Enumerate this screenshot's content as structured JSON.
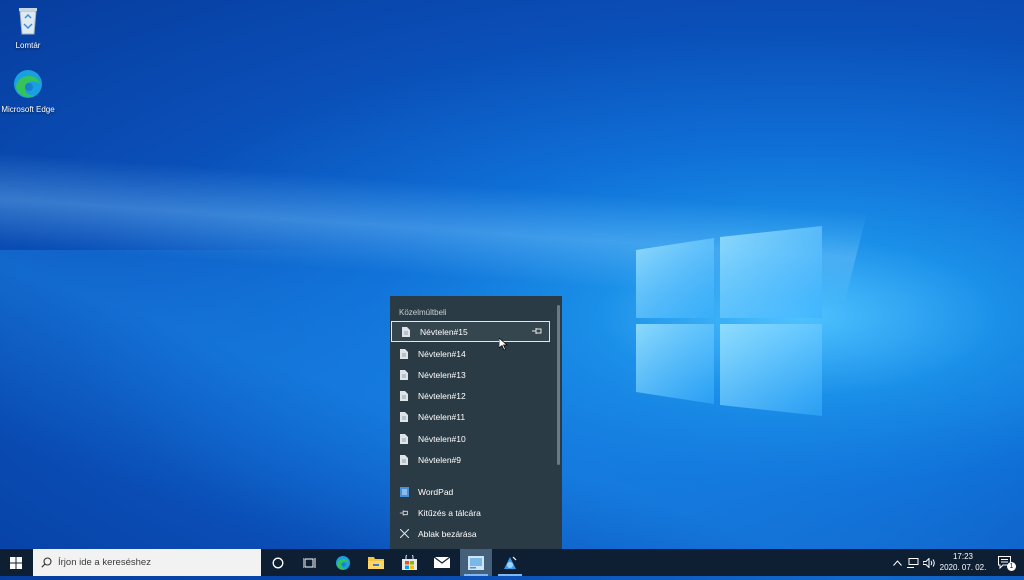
{
  "desktop": {
    "icons": [
      {
        "label": "Lomtár",
        "icon": "recycle-bin-icon"
      },
      {
        "label": "Microsoft Edge",
        "icon": "edge-icon"
      }
    ]
  },
  "jumplist": {
    "header": "Közelmúltbeli",
    "recent": [
      {
        "label": "Névtelen#15",
        "selected": true
      },
      {
        "label": "Névtelen#14"
      },
      {
        "label": "Névtelen#13"
      },
      {
        "label": "Névtelen#12"
      },
      {
        "label": "Névtelen#11"
      },
      {
        "label": "Névtelen#10"
      },
      {
        "label": "Névtelen#9"
      }
    ],
    "tasks": [
      {
        "label": "WordPad",
        "icon": "wordpad-icon"
      },
      {
        "label": "Kitűzés a tálcára",
        "icon": "pin-icon"
      },
      {
        "label": "Ablak bezárása",
        "icon": "close-icon"
      }
    ]
  },
  "taskbar": {
    "search_placeholder": "Írjon ide a kereséshez",
    "apps": [
      "cortana-icon",
      "task-view-icon",
      "edge-icon",
      "file-explorer-icon",
      "store-icon",
      "mail-icon",
      "paint-icon",
      "app-icon"
    ],
    "clock": {
      "time": "17:23",
      "date": "2020. 07. 02."
    },
    "notifications": "1"
  },
  "colors": {
    "accent": "#0f6fd6",
    "taskbar": "#0e1f33",
    "jumplist": "#2b3b45"
  }
}
